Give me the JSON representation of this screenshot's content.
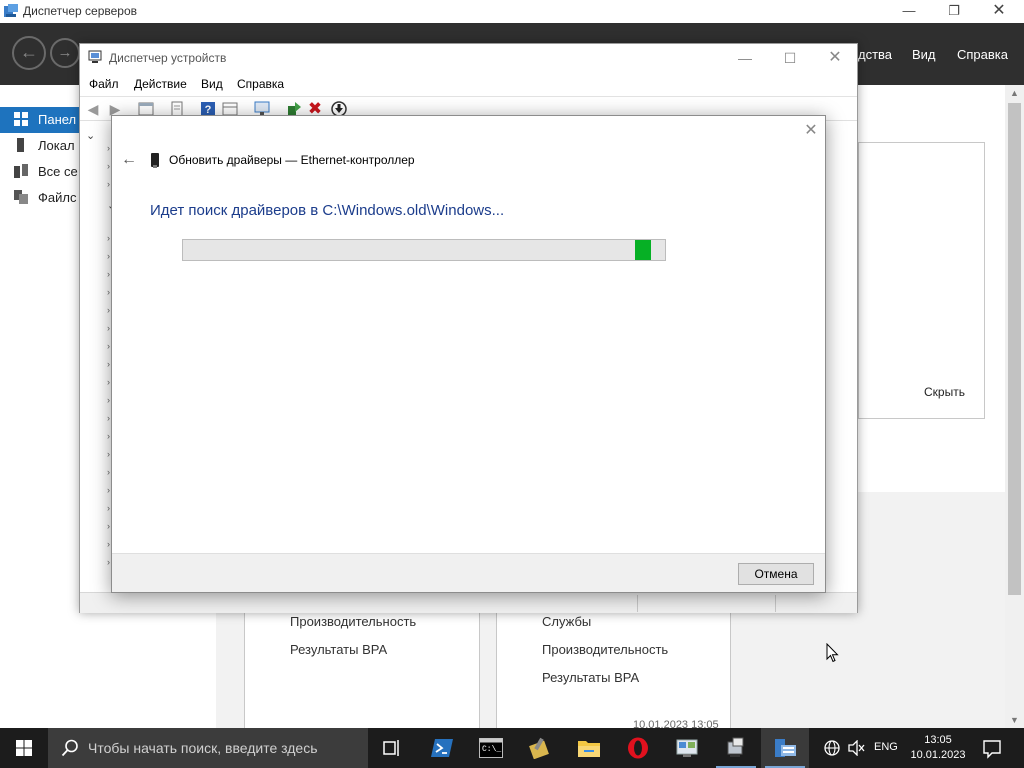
{
  "server_manager": {
    "title": "Диспетчер серверов",
    "menu": {
      "tools_partial": "дства",
      "view": "Вид",
      "help": "Справка"
    },
    "nav": [
      {
        "label": "Панел"
      },
      {
        "label": "Локал"
      },
      {
        "label": "Все се"
      },
      {
        "label": "Файлс"
      }
    ],
    "hide_label": "Скрыть",
    "cards": [
      {
        "items": [
          "Производительность",
          "Результаты BPA"
        ]
      },
      {
        "items": [
          "Службы",
          "Производительность",
          "Результаты BPA"
        ]
      }
    ],
    "partial_timestamp": "10.01.2023 13:05"
  },
  "device_manager": {
    "title": "Диспетчер устройств",
    "menu": [
      "Файл",
      "Действие",
      "Вид",
      "Справка"
    ]
  },
  "dialog": {
    "heading": "Обновить драйверы — Ethernet-контроллер",
    "status": "Идет поиск драйверов в C:\\Windows.old\\Windows...",
    "progress": {
      "value": 0.97,
      "color": "#06b025"
    },
    "cancel_label": "Отмена"
  },
  "taskbar": {
    "search_placeholder": "Чтобы начать поиск, введите здесь",
    "apps": [
      "task-view-icon",
      "powershell-icon",
      "command-prompt-icon",
      "tool-icon",
      "file-explorer-icon",
      "opera-icon",
      "control-panel-icon",
      "network-tool-icon",
      "server-manager-icon"
    ],
    "language": "ENG",
    "time": "13:05",
    "date": "10.01.2023"
  }
}
